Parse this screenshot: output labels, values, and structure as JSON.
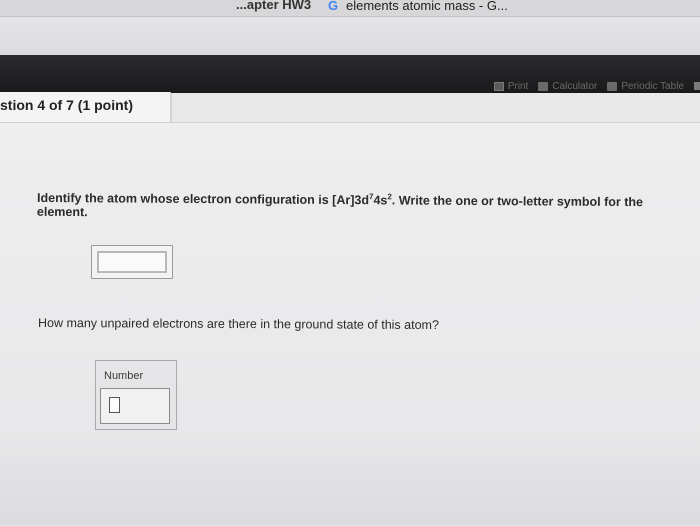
{
  "browser": {
    "left_tab_fragment": "...apter HW3",
    "active_tab_icon": "google-g-icon",
    "active_tab_title": "elements atomic mass - G..."
  },
  "toolbar": {
    "print_label": "Print",
    "calculator_label": "Calculator",
    "periodic_table_label": "Periodic Table"
  },
  "question": {
    "header": "stion 4 of 7 (1 point)",
    "part1_before_sup": "Identify the atom whose electron configuration is [Ar]3d",
    "part1_sup1": "7",
    "part1_mid": "4s",
    "part1_sup2": "2",
    "part1_after": ". Write the one or two-letter symbol for the element.",
    "part1_answer": "",
    "part2_text": "How many unpaired electrons are there in the ground state of this atom?",
    "part2_field_label": "Number",
    "part2_answer": ""
  },
  "colors": {
    "toolbar_bg": "#1f1f21",
    "panel_bg": "#ebebec",
    "google_blue": "#4285f4"
  }
}
